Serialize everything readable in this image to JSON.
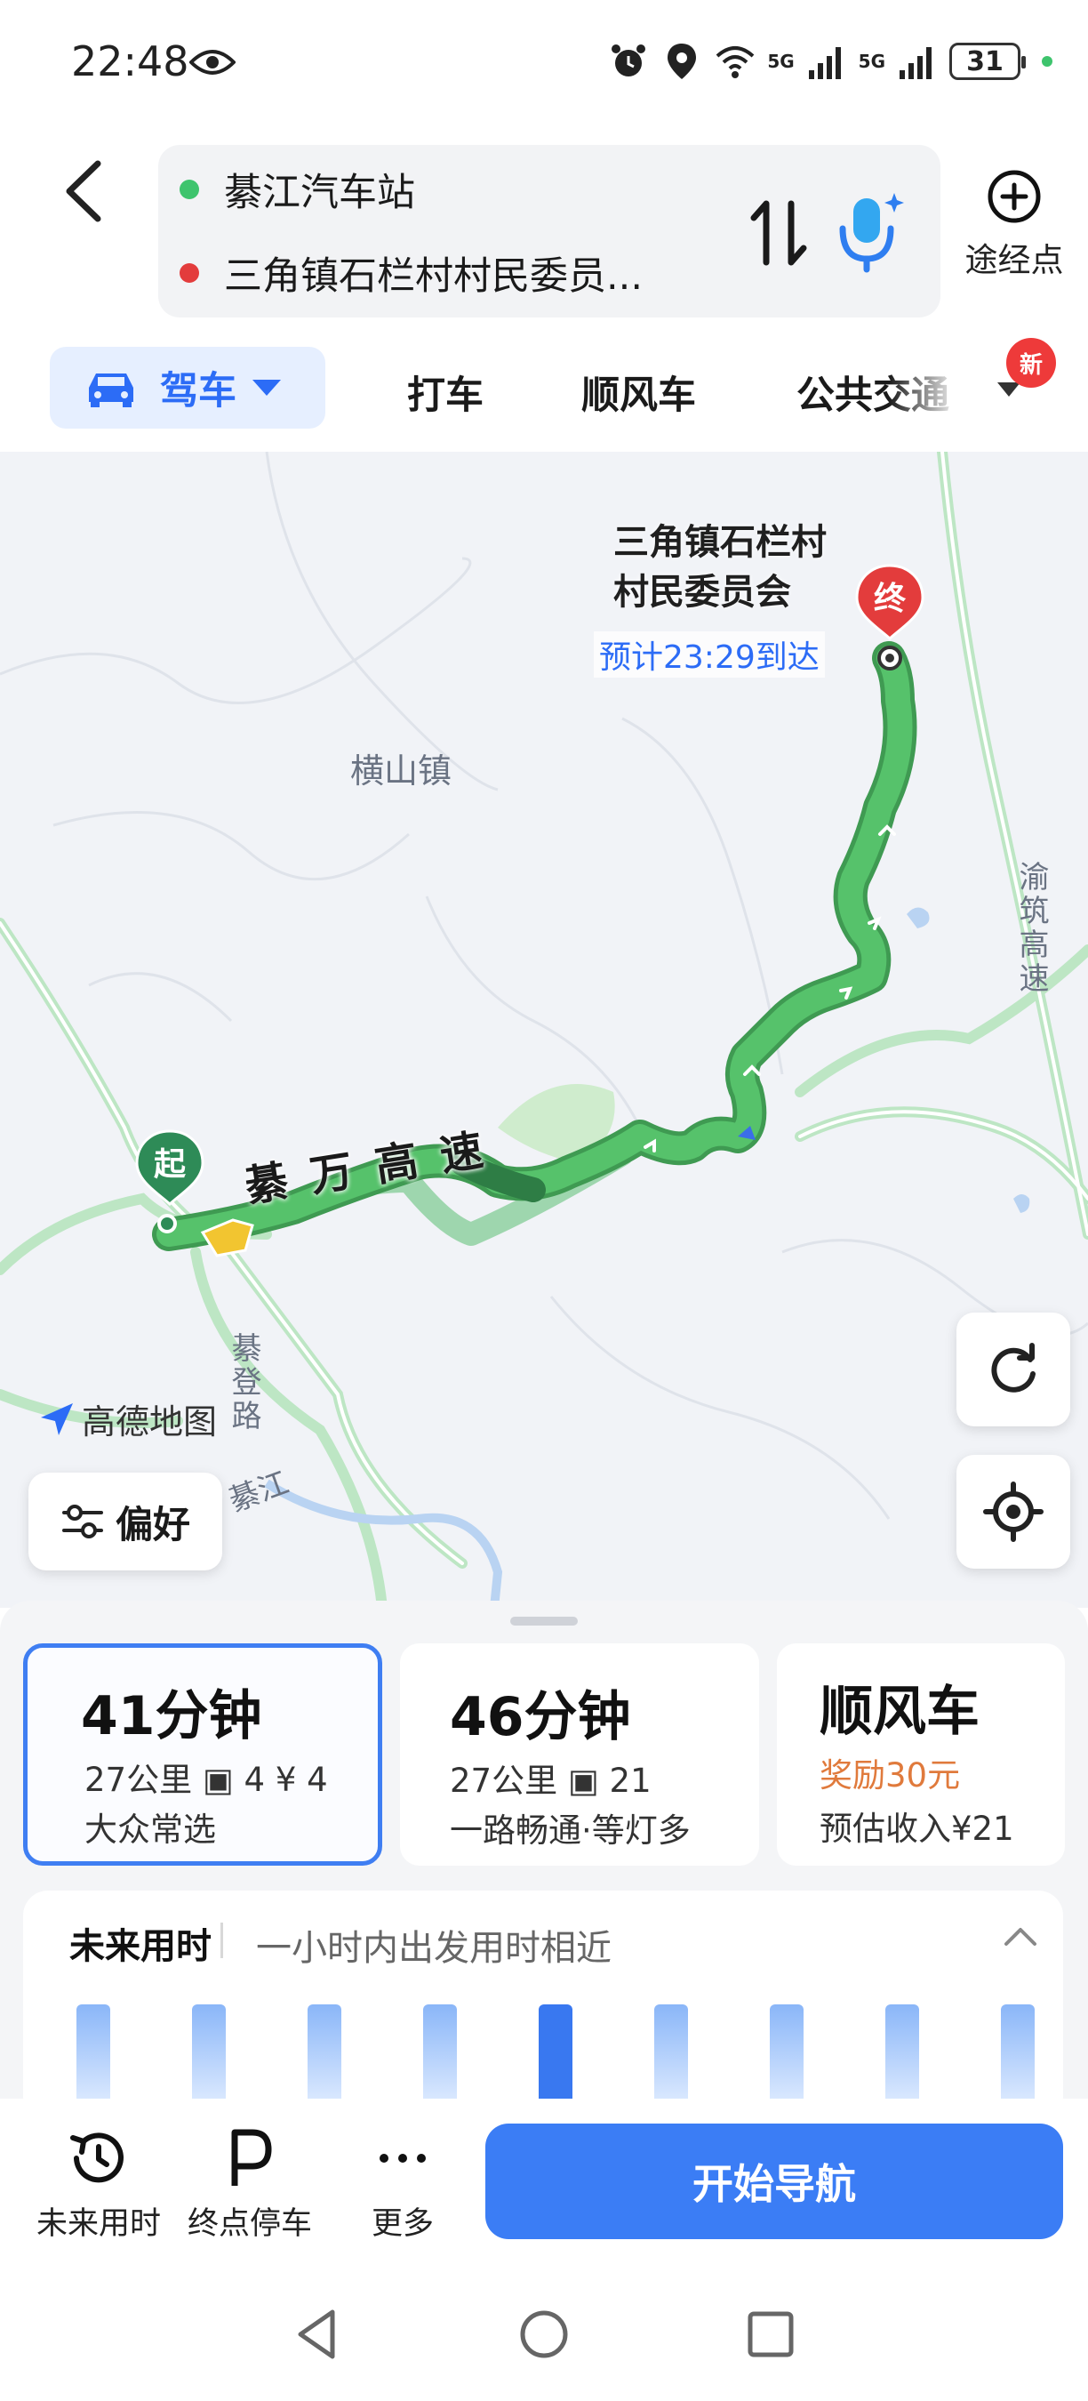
{
  "status": {
    "time": "22:48",
    "battery": "31",
    "net1": "5G",
    "net2": "5G"
  },
  "route": {
    "origin": "綦江汽车站",
    "destination": "三角镇石栏村村民委员...",
    "waypoint_label": "途经点",
    "colors": {
      "origin": "#3ec46d",
      "destination": "#e33c3c"
    }
  },
  "modes": {
    "drive": "驾车",
    "taxi": "打车",
    "carpool": "顺风车",
    "transit": "公共交通",
    "new_badge": "新"
  },
  "map": {
    "dest_name_line1": "三角镇石栏村",
    "dest_name_line2": "村民委员会",
    "eta": "预计23:29到达",
    "town": "横山镇",
    "highway": "綦万高速",
    "expressway_vertical": "渝筑高速",
    "road_vertical": "綦登路",
    "river": "綦江",
    "brand": "高德地图",
    "start_pin": "起",
    "end_pin": "终",
    "preference": "偏好",
    "route_color": "#4cb865"
  },
  "options": [
    {
      "time": "41分钟",
      "detail": "27公里 ▣ 4 ¥ 4",
      "tag": "大众常选",
      "selected": true
    },
    {
      "time": "46分钟",
      "detail": "27公里 ▣ 21",
      "tag": "一路畅通·等灯多"
    },
    {
      "title": "顺风车",
      "reward": "奖励30元",
      "income": "预估收入¥21"
    }
  ],
  "future": {
    "title": "未来用时",
    "subtitle": "一小时内出发用时相近",
    "active_bar_index": 4
  },
  "actions": {
    "future_time": "未来用时",
    "parking": "终点停车",
    "more": "更多",
    "start": "开始导航",
    "accent": "#3b7df5"
  }
}
